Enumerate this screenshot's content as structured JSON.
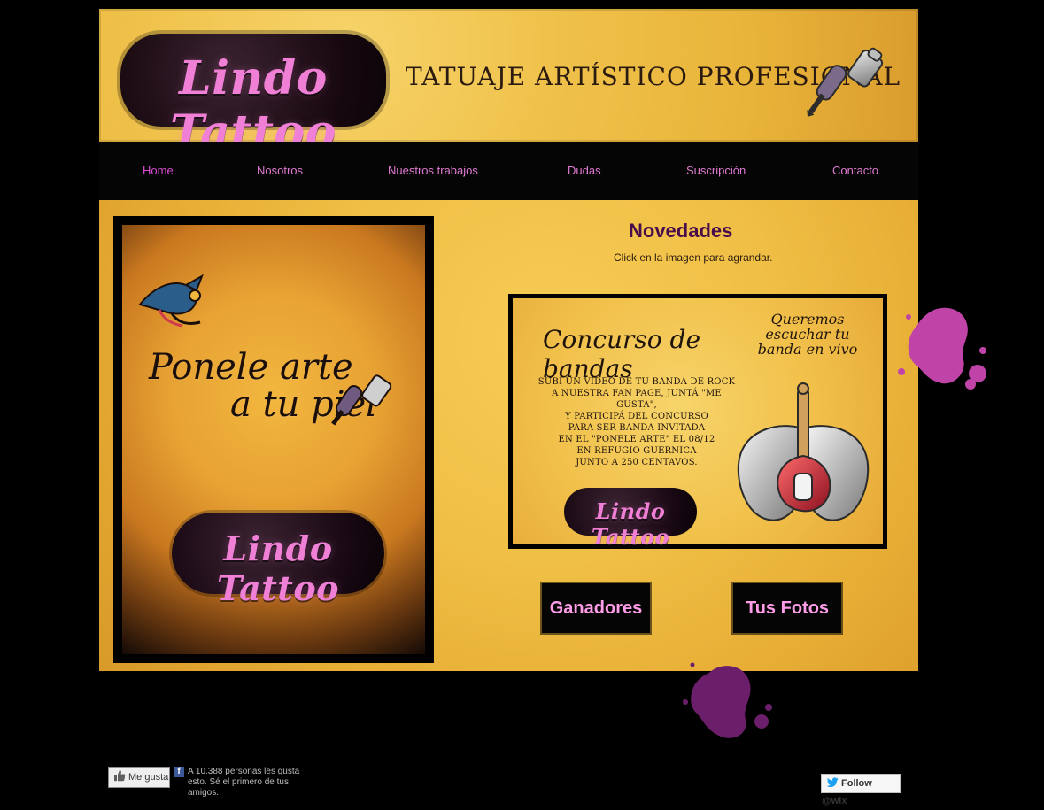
{
  "brand": {
    "name": "Lindo Tattoo",
    "tagline": "TATUAJE ARTÍSTICO PROFESIONAL"
  },
  "nav": {
    "items": [
      {
        "label": "Home"
      },
      {
        "label": "Nosotros"
      },
      {
        "label": "Nuestros trabajos"
      },
      {
        "label": "Dudas"
      },
      {
        "label": "Suscripción"
      },
      {
        "label": "Contacto"
      }
    ],
    "active_index": 0
  },
  "left_poster": {
    "title_line1": "Ponele arte",
    "title_line2": "a tu piel",
    "logo_text": "Lindo Tattoo"
  },
  "news": {
    "title": "Novedades",
    "subtitle": "Click en la imagen para agrandar."
  },
  "flyer": {
    "title": "Concurso de bandas",
    "subtitle": "Queremos escuchar tu banda en vivo",
    "body_lines": [
      "SUBÍ UN VIDEO DE TU BANDA DE ROCK",
      "A NUESTRA FAN PAGE, JUNTÁ \"ME GUSTA\",",
      "Y PARTICIPÁ DEL CONCURSO",
      "PARA SER BANDA INVITADA",
      "EN EL \"PONELE ARTE\" EL 08/12",
      "EN REFUGIO GUERNICA",
      "JUNTO A 250 CENTAVOS."
    ],
    "logo_text": "Lindo Tattoo"
  },
  "buttons": {
    "ganadores": "Ganadores",
    "tus_fotos": "Tus Fotos"
  },
  "footer": {
    "fb_like_label": "Me gusta",
    "fb_count_text": "A 10.388 personas les gusta esto. Sé el primero de tus amigos.",
    "tw_follow_label": "Follow @wix"
  },
  "colors": {
    "page_bg": "#000000",
    "paper_yellow": "#f0c24b",
    "nav_text": "#e07ad2",
    "nav_active": "#d94ccf",
    "novedades": "#4a0d4c",
    "ink_pink": "#c043a8",
    "ink_purple": "#6b1f6b"
  },
  "icons": {
    "header_machine": "tattoo-machine-icon",
    "poster_machine": "tattoo-machine-icon",
    "bird": "swallow-bird-icon",
    "guitar": "winged-guitar-icon",
    "fb": "facebook-f-icon",
    "fb_like": "thumbs-up-icon",
    "twitter": "twitter-bird-icon",
    "splatter": "ink-splatter-icon"
  }
}
